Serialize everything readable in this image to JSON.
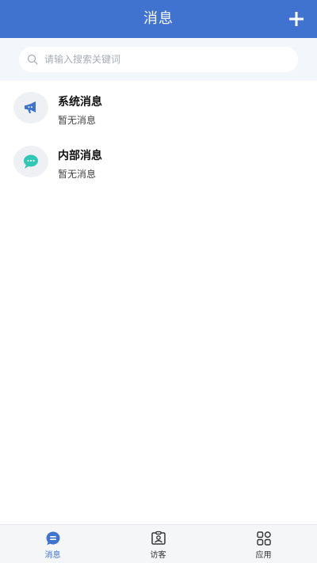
{
  "header": {
    "title": "消息"
  },
  "search": {
    "placeholder": "请输入搜索关键词"
  },
  "messages": [
    {
      "title": "系统消息",
      "subtitle": "暂无消息",
      "icon": "megaphone-icon"
    },
    {
      "title": "内部消息",
      "subtitle": "暂无消息",
      "icon": "chat-bubble-icon"
    }
  ],
  "nav": {
    "items": [
      {
        "label": "消息",
        "icon": "message-icon",
        "active": true
      },
      {
        "label": "访客",
        "icon": "visitor-badge-icon",
        "active": false
      },
      {
        "label": "应用",
        "icon": "apps-grid-icon",
        "active": false
      }
    ]
  },
  "colors": {
    "primary": "#3f73cf",
    "chat_icon": "#2ec8b5",
    "background_search": "#f3f6fb"
  }
}
